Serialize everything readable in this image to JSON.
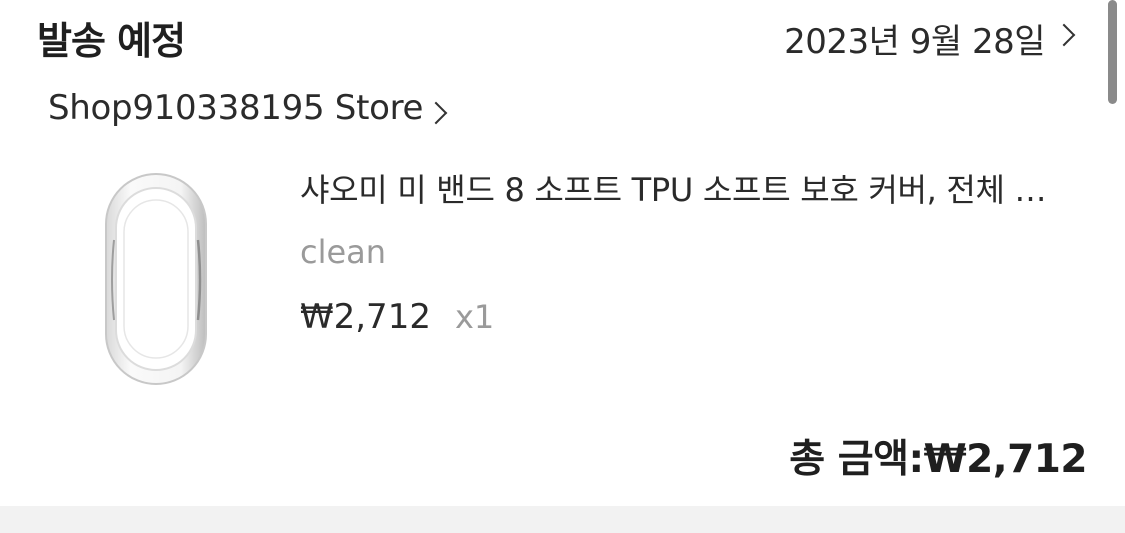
{
  "order": {
    "status_title": "발송 예정",
    "ship_date": "2023년 9월 28일",
    "store_name": "Shop910338195 Store",
    "item": {
      "title": "샤오미 미 밴드 8 소프트 TPU 소프트 보호 커버, 전체 …",
      "variant": "clean",
      "price": "₩2,712",
      "quantity": "x1",
      "thumbnail_icon": "band-cover-thumbnail"
    },
    "total_label": "총 금액:",
    "total_value": "₩2,712"
  }
}
